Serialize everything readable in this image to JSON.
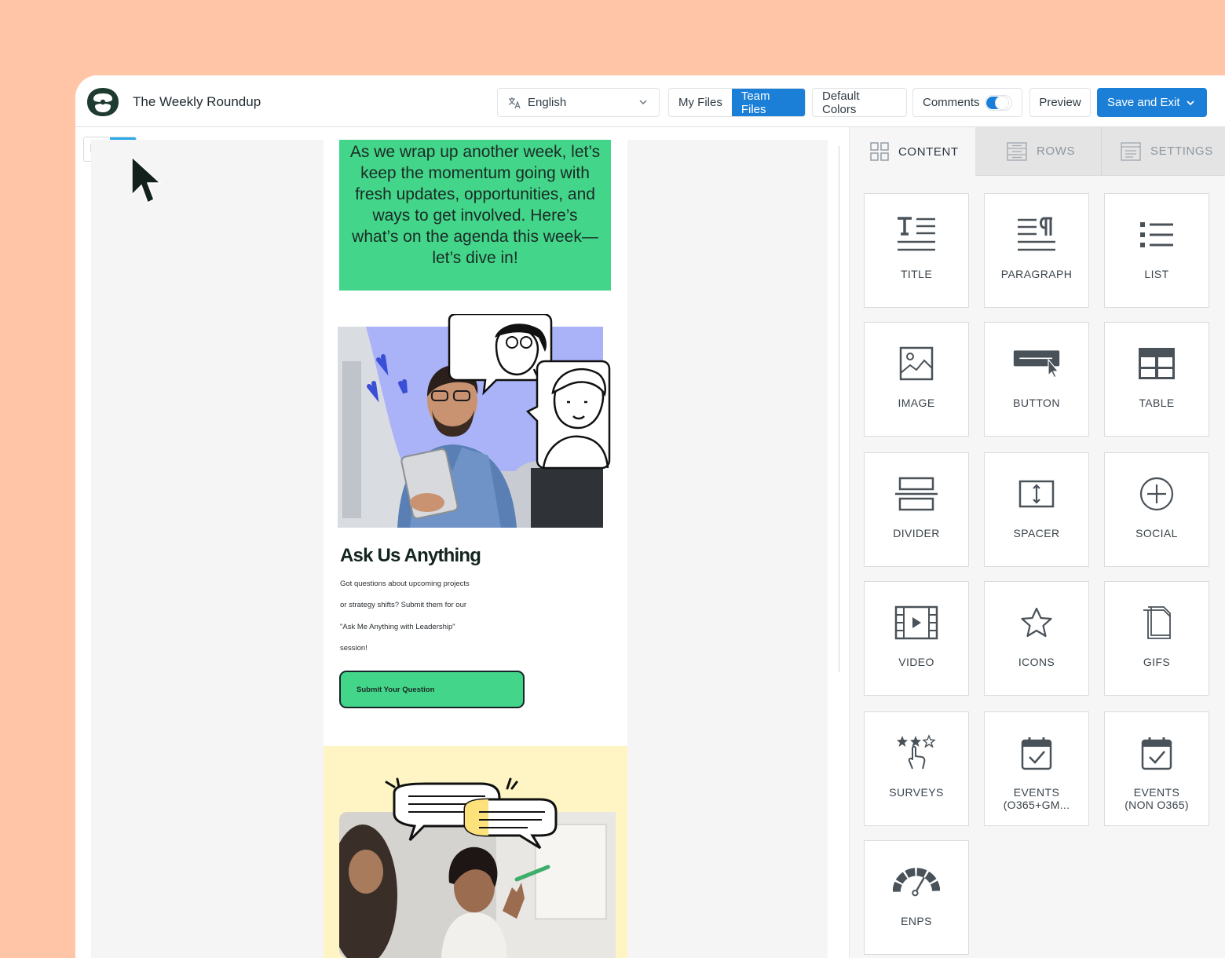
{
  "header": {
    "title": "The Weekly Roundup",
    "language": "English",
    "my_files": "My Files",
    "team_files": "Team Files",
    "default_colors": "Default Colors",
    "comments": "Comments",
    "comments_enabled": true,
    "preview": "Preview",
    "save_exit": "Save and Exit"
  },
  "email": {
    "intro": "As we wrap up another week, let’s keep the momentum going with fresh updates, opportunities, and ways to get involved. Here’s what’s on the agenda this week—let’s dive in!",
    "ama_title": "Ask Us Anything",
    "ama_lines": [
      "Got questions about upcoming projects",
      "or strategy shifts? Submit them for our",
      "\"Ask Me Anything with Leadership\"",
      "session!"
    ],
    "ama_button": "Submit Your Question"
  },
  "panel": {
    "tabs": {
      "content": "CONTENT",
      "rows": "ROWS",
      "settings": "SETTINGS"
    },
    "active_tab": "content",
    "tiles": {
      "title": "TITLE",
      "paragraph": "PARAGRAPH",
      "list": "LIST",
      "image": "IMAGE",
      "button": "BUTTON",
      "table": "TABLE",
      "divider": "DIVIDER",
      "spacer": "SPACER",
      "social": "SOCIAL",
      "video": "VIDEO",
      "icons": "ICONS",
      "gifs": "GIFS",
      "surveys": "SURVEYS",
      "events_o365_1": "EVENTS",
      "events_o365_2": "(O365+GM...",
      "events_non_1": "EVENTS",
      "events_non_2": "(NON O365)",
      "enps": "ENPS"
    }
  },
  "colors": {
    "accent": "#1b7fd8",
    "device_active": "#29a8e8",
    "email_green": "#43d68a",
    "email_yellow": "#fff5c4",
    "page_bg": "#ffc5a6"
  },
  "device_mode": "mobile"
}
